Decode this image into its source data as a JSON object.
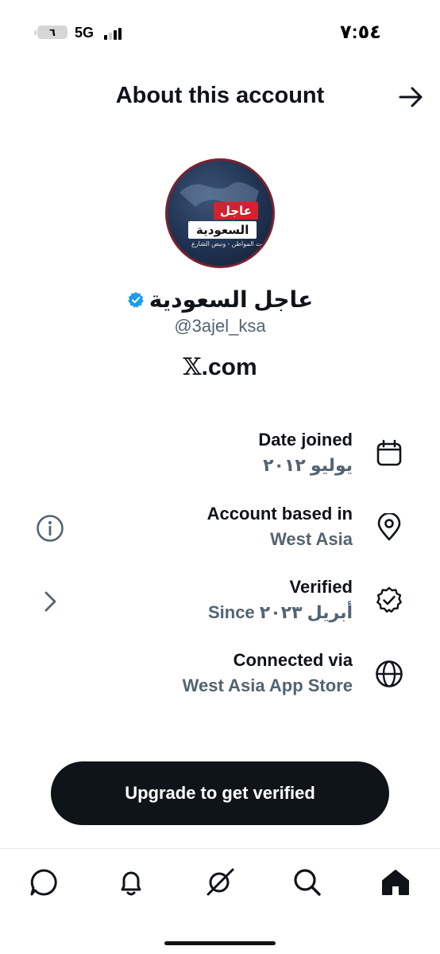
{
  "status_bar": {
    "battery": "٦",
    "network": "5G",
    "time": "٧:٥٤"
  },
  "header": {
    "title": "About this account",
    "back_icon": "arrow-right-icon"
  },
  "profile": {
    "avatar_text_primary": "عاجل",
    "avatar_text_secondary": "السعودية",
    "avatar_tagline": "صوت المواطن - ونبض الشارع",
    "name": "عاجل السعودية",
    "verified_icon": "blue-check-icon",
    "verified_color": "#1d9bf0",
    "handle": "@3ajel_ksa",
    "site_glyph": "𝕏",
    "site_suffix": ".com"
  },
  "details": [
    {
      "label": "Date joined",
      "value": "يوليو ٢٠١٢",
      "icon": "calendar-icon"
    },
    {
      "label": "Account based in",
      "value": "West Asia",
      "icon": "location-pin-icon",
      "left_icon": "info-icon"
    },
    {
      "label": "Verified",
      "value": "Since أبريل ٢٠٢٣",
      "icon": "verified-badge-icon",
      "left_icon": "chevron-right-icon"
    },
    {
      "label": "Connected via",
      "value": "West Asia App Store",
      "icon": "globe-icon"
    }
  ],
  "cta": {
    "label": "Upgrade to get verified"
  },
  "tabbar": {
    "tabs": [
      "messages-icon",
      "notifications-icon",
      "grok-icon",
      "search-icon",
      "home-icon"
    ],
    "active": "home-icon"
  },
  "colors": {
    "text": "#0f1419",
    "secondary": "#536471",
    "button_bg": "#0f1419"
  }
}
